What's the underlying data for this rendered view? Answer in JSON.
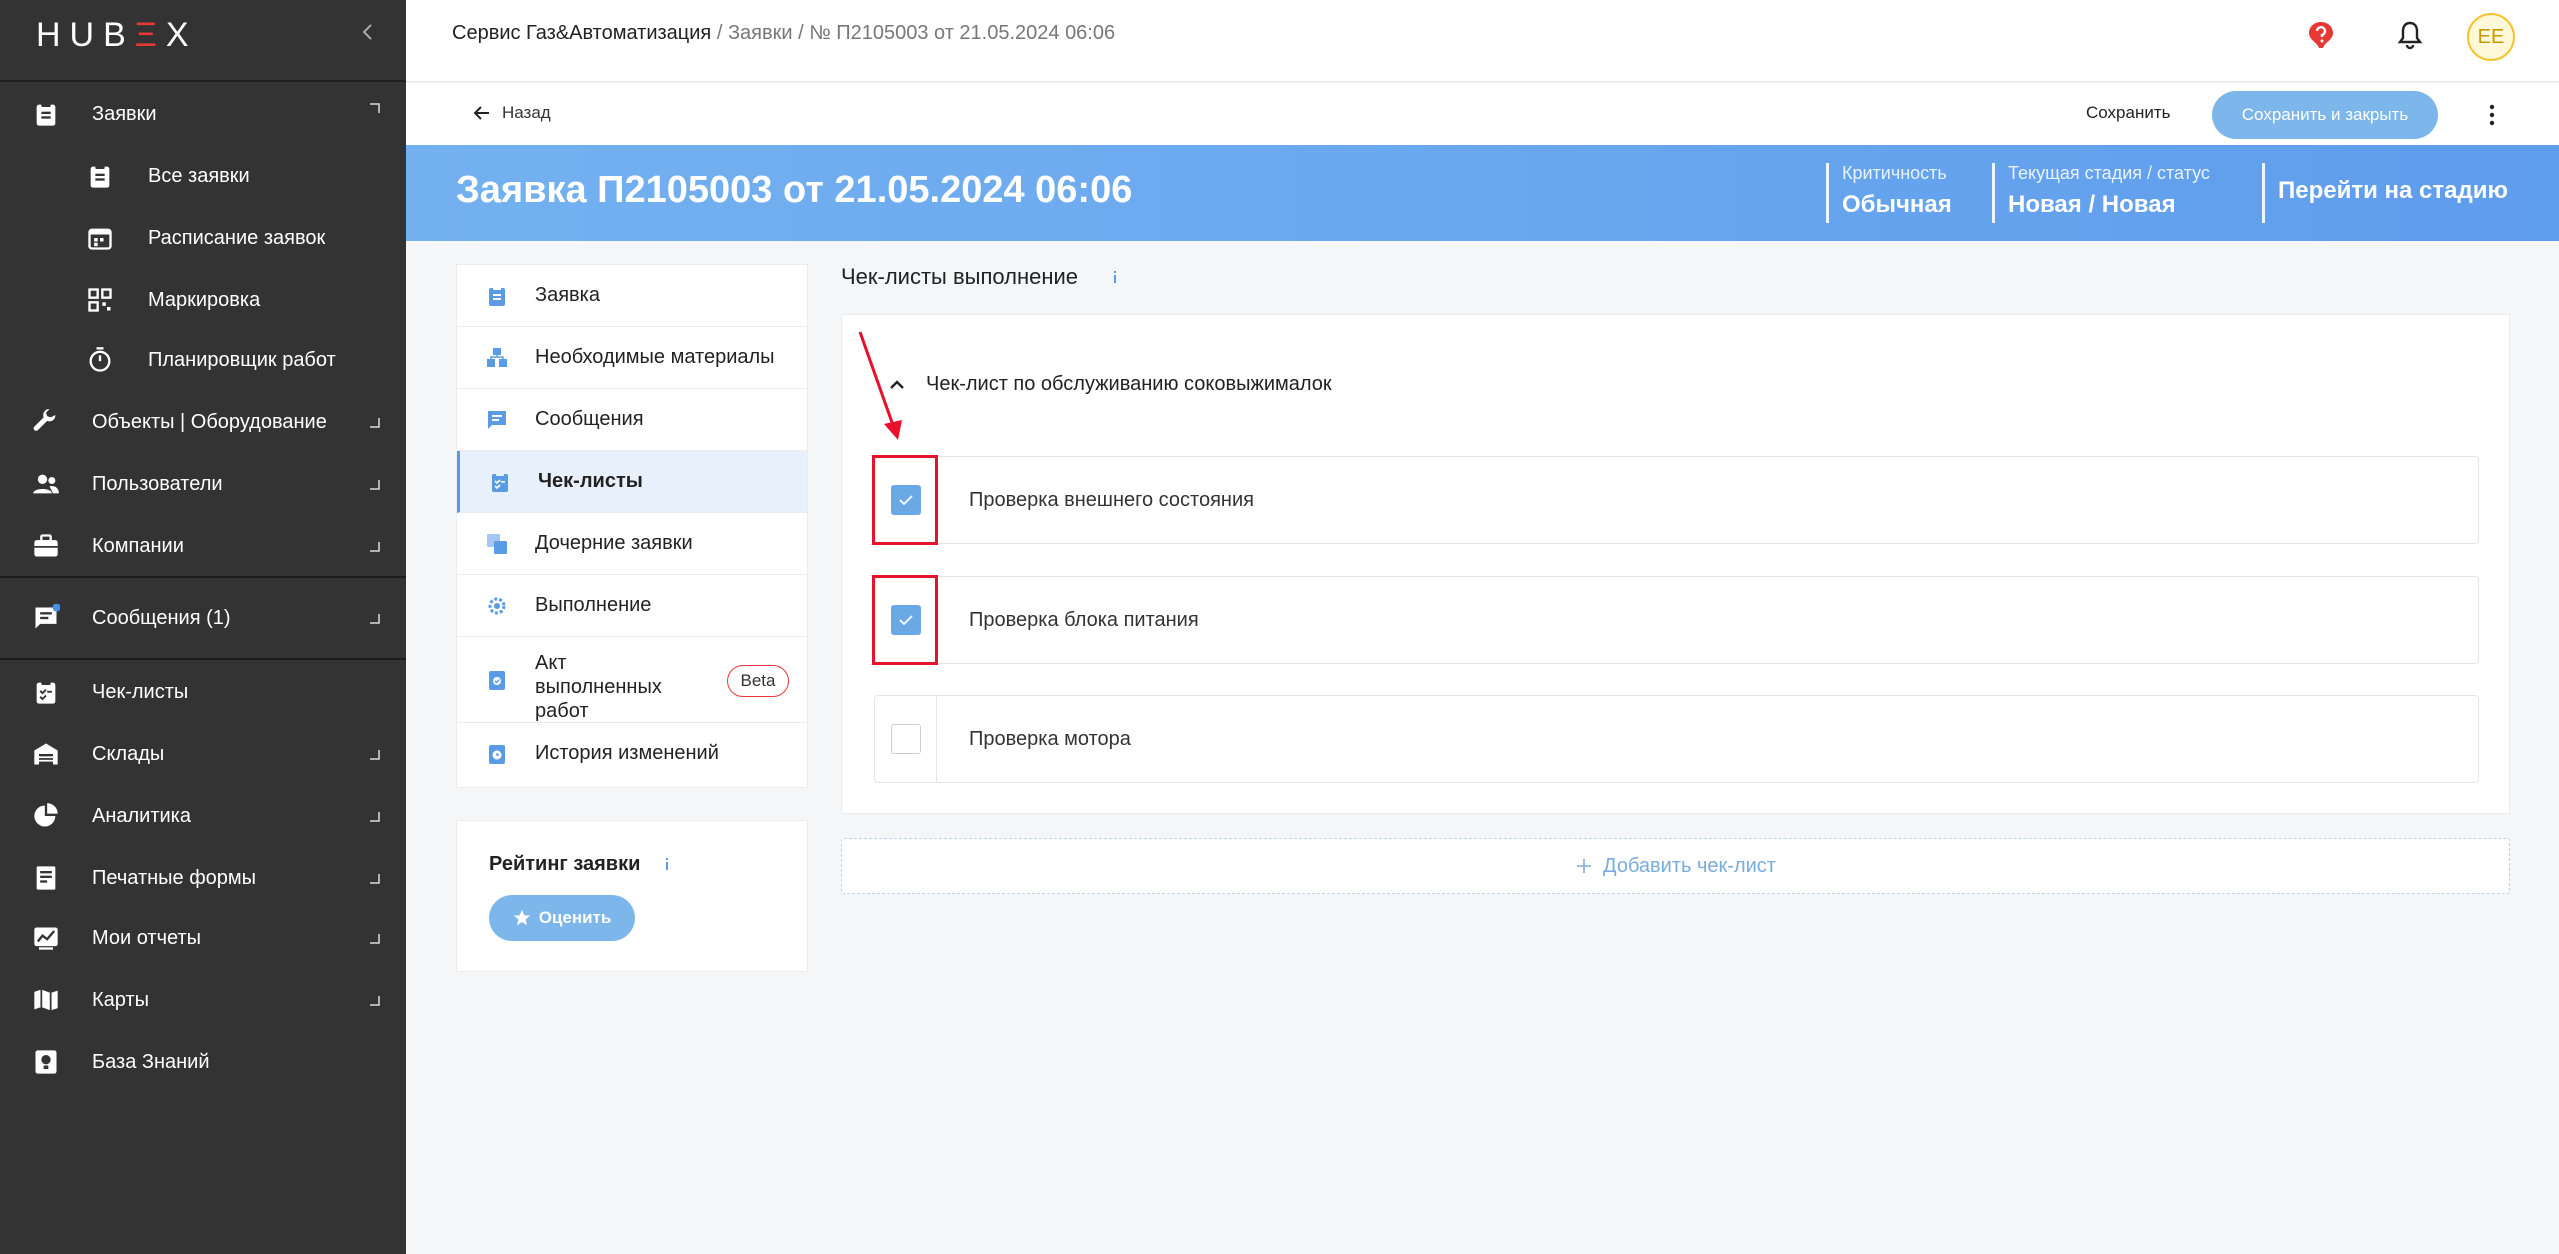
{
  "app": {
    "logo_left": "HUB",
    "logo_accent": "Ξ",
    "logo_right": "X"
  },
  "sidebar": {
    "items": [
      {
        "label": "Заявки",
        "icon": "clipboard-icon",
        "has_arrow": true
      },
      {
        "label": "Все заявки",
        "icon": "clipboard-icon"
      },
      {
        "label": "Расписание заявок",
        "icon": "calendar-icon"
      },
      {
        "label": "Маркировка",
        "icon": "qr-code-icon"
      },
      {
        "label": "Планировщик работ",
        "icon": "timer-icon"
      },
      {
        "label": "Объекты | Оборудование",
        "icon": "wrench-icon",
        "has_arrow": true
      },
      {
        "label": "Пользователи",
        "icon": "users-icon",
        "has_arrow": true
      },
      {
        "label": "Компании",
        "icon": "briefcase-icon",
        "has_arrow": true
      },
      {
        "label": "Сообщения (1)",
        "icon": "chat-icon",
        "has_arrow": true
      },
      {
        "label": "Чек-листы",
        "icon": "checklist-icon"
      },
      {
        "label": "Склады",
        "icon": "warehouse-icon",
        "has_arrow": true
      },
      {
        "label": "Аналитика",
        "icon": "pie-chart-icon",
        "has_arrow": true
      },
      {
        "label": "Печатные формы",
        "icon": "printed-form-icon",
        "has_arrow": true
      },
      {
        "label": "Мои отчеты",
        "icon": "reports-icon",
        "has_arrow": true
      },
      {
        "label": "Карты",
        "icon": "map-icon",
        "has_arrow": true
      },
      {
        "label": "База Знаний",
        "icon": "knowledge-base-icon"
      }
    ]
  },
  "breadcrumb": {
    "company": "Сервис Газ&Автоматизация",
    "sep1": " / ",
    "section": "Заявки",
    "sep2": " / ",
    "current": "№ П2105003 от 21.05.2024 06:06"
  },
  "user": {
    "initials": "EE"
  },
  "actions": {
    "back": "Назад",
    "save": "Сохранить",
    "save_close": "Сохранить и закрыть"
  },
  "header": {
    "title": "Заявка П2105003 от 21.05.2024 06:06",
    "criticality_label": "Критичность",
    "criticality_value": "Обычная",
    "stage_label": "Текущая стадия / статус",
    "stage_value": "Новая / Новая",
    "go_to_stage": "Перейти на стадию"
  },
  "tabs": [
    {
      "label": "Заявка",
      "icon": "clipboard-icon"
    },
    {
      "label": "Необходимые материалы",
      "icon": "boxes-icon"
    },
    {
      "label": "Сообщения",
      "icon": "chat-icon"
    },
    {
      "label": "Чек-листы",
      "icon": "checklist-icon",
      "active": true
    },
    {
      "label": "Дочерние заявки",
      "icon": "child-requests-icon"
    },
    {
      "label": "Выполнение",
      "icon": "gear-icon"
    },
    {
      "label": "Акт выполненных работ",
      "icon": "act-icon",
      "badge": "Beta"
    },
    {
      "label": "История изменений",
      "icon": "history-icon"
    }
  ],
  "rating": {
    "title": "Рейтинг заявки",
    "button": "Оценить"
  },
  "checklists": {
    "section_title": "Чек-листы выполнение",
    "list_title": "Чек-лист по обслуживанию соковыжималок",
    "items": [
      {
        "label": "Проверка внешнего состояния",
        "checked": true
      },
      {
        "label": "Проверка блока питания",
        "checked": true
      },
      {
        "label": "Проверка мотора",
        "checked": false
      }
    ],
    "add_button": "Добавить чек-лист"
  },
  "colors": {
    "sidebar_bg": "#333333",
    "accent_blue": "#5b9be3",
    "header_gradient_start": "#74b1f0",
    "header_gradient_end": "#5f9ded",
    "annotation_red": "#e8102a"
  }
}
